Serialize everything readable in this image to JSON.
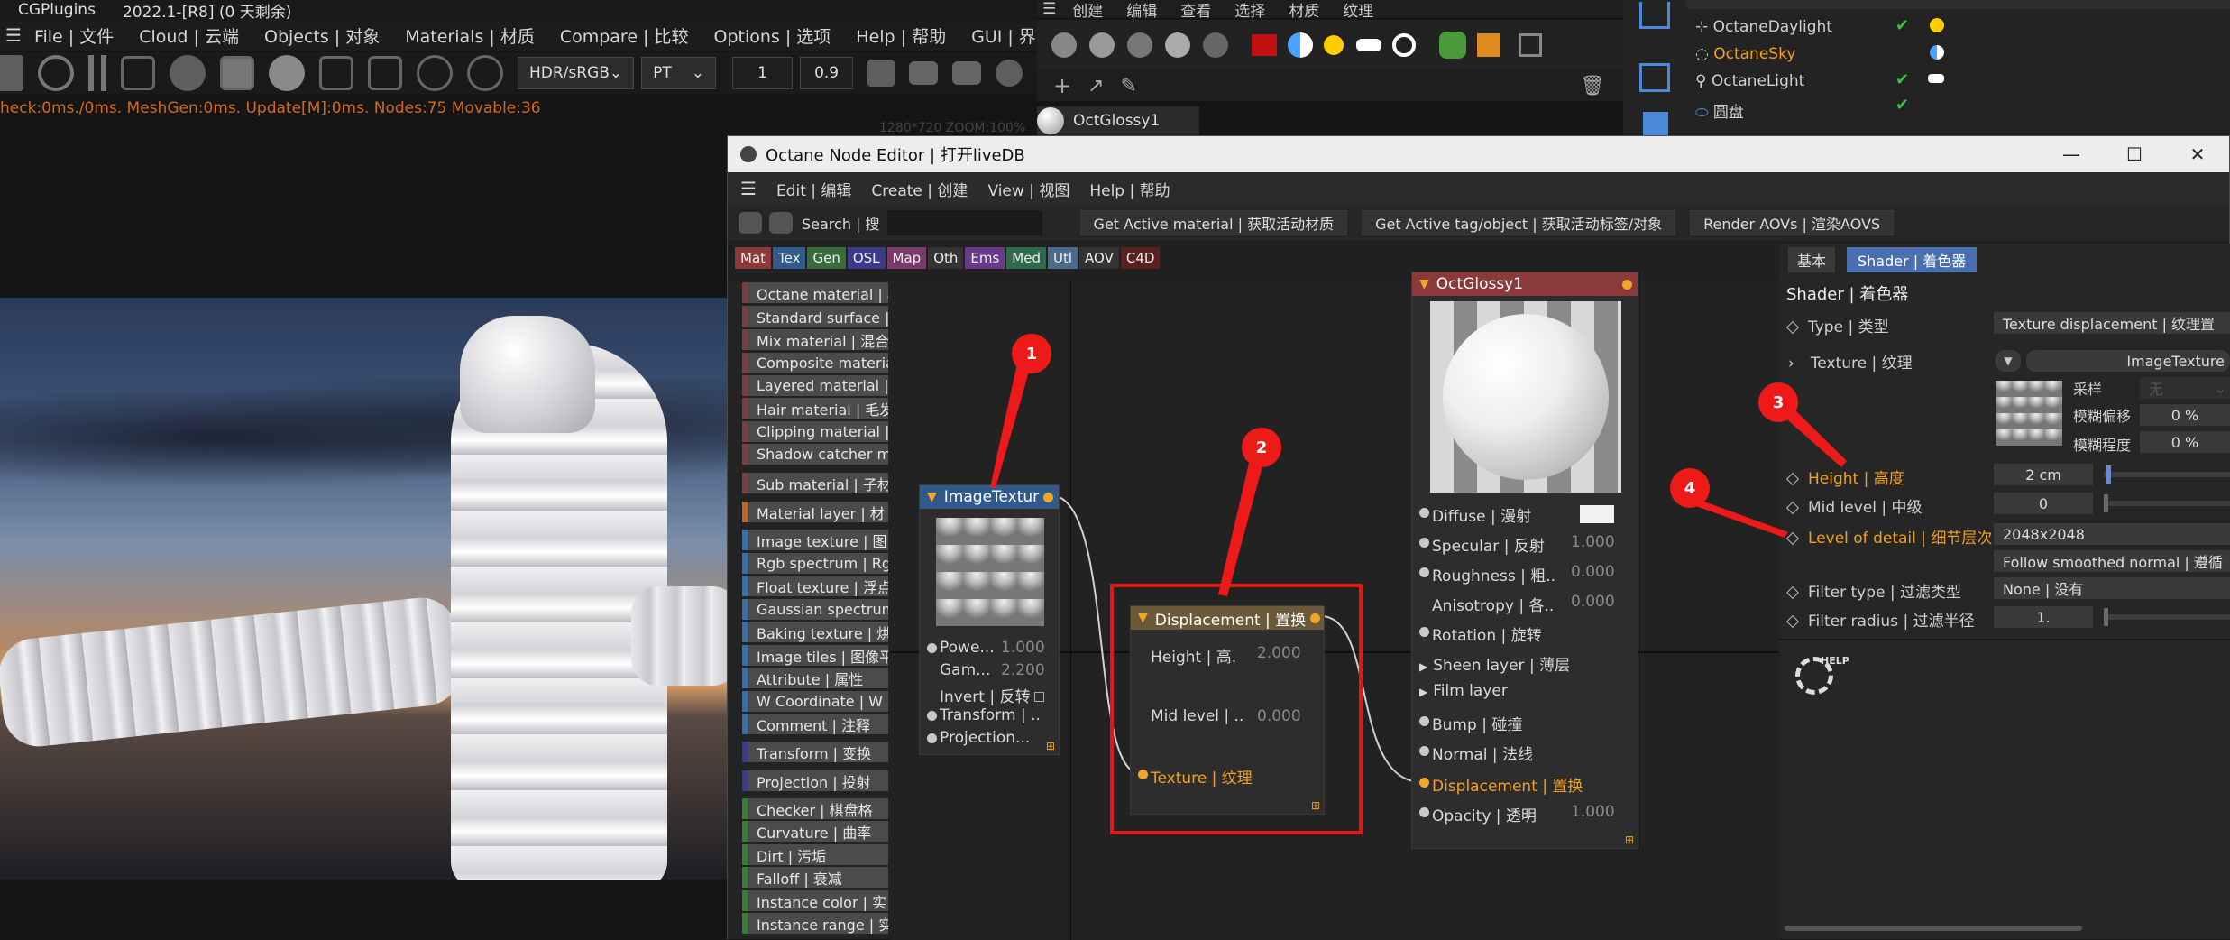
{
  "app": {
    "title": "CGPlugins",
    "version": "2022.1-[R8] (0 天剩余)"
  },
  "main_menu": [
    "File | 文件",
    "Cloud | 云端",
    "Objects | 对象",
    "Materials | 材质",
    "Compare | 比较",
    "Options | 选项",
    "Help | 帮助",
    "GUI | 界面"
  ],
  "toolbar": {
    "color_space": "HDR/sRGB",
    "kernel": "PT",
    "value1": "1",
    "value2": "0.9"
  },
  "status_line": "heck:0ms./0ms. MeshGen:0ms. Update[M]:0ms. Nodes:75 Movable:36",
  "viewport_overlay": "1280*720 ZOOM:100%",
  "c4d_menu": [
    "创建",
    "编辑",
    "查看",
    "选择",
    "材质",
    "纹理"
  ],
  "material_name": "OctGlossy1",
  "objects": [
    {
      "name": "OctaneDaylight",
      "highlight": false
    },
    {
      "name": "OctaneSky",
      "highlight": true
    },
    {
      "name": "OctaneLight",
      "highlight": false
    },
    {
      "name": "圆盘",
      "highlight": false
    }
  ],
  "node_editor": {
    "title": "Octane Node Editor | 打开liveDB",
    "menu": [
      "Edit | 编辑",
      "Create | 创建",
      "View | 视图",
      "Help | 帮助"
    ],
    "search_label": "Search | 搜",
    "buttons": [
      "Get Active material | 获取活动材质",
      "Get Active tag/object | 获取活动标签/对象",
      "Render AOVs | 渲染AOVS"
    ],
    "categories": [
      {
        "label": "Mat",
        "color": "#8a3a3a"
      },
      {
        "label": "Tex",
        "color": "#2f5a8a"
      },
      {
        "label": "Gen",
        "color": "#3a6b3a"
      },
      {
        "label": "OSL",
        "color": "#3a3a8a"
      },
      {
        "label": "Map",
        "color": "#7a3a6a"
      },
      {
        "label": "Oth",
        "color": "#333333"
      },
      {
        "label": "Ems",
        "color": "#6a3a8a"
      },
      {
        "label": "Med",
        "color": "#2f6a4a"
      },
      {
        "label": "Utl",
        "color": "#4a6a8a"
      },
      {
        "label": "AOV",
        "color": "#333333"
      },
      {
        "label": "C4D",
        "color": "#5a2020"
      }
    ],
    "palette": [
      {
        "label": "Octane material | 材",
        "color": "#9a4a4a"
      },
      {
        "label": "Standard surface | 标",
        "color": "#9a4a4a"
      },
      {
        "label": "Mix material | 混合",
        "color": "#9a4a4a"
      },
      {
        "label": "Composite material",
        "color": "#9a4a4a"
      },
      {
        "label": "Layered material |",
        "color": "#9a4a4a"
      },
      {
        "label": "Hair material | 毛发",
        "color": "#9a4a4a"
      },
      {
        "label": "Clipping material |",
        "color": "#9a4a4a"
      },
      {
        "label": "Shadow catcher m",
        "color": "#9a4a4a"
      },
      {
        "label": "Sub material | 子材",
        "color": "#9a4a4a"
      },
      {
        "label": "Material layer | 材",
        "color": "#b8682a"
      },
      {
        "label": "Image texture | 图",
        "color": "#3a6ea8"
      },
      {
        "label": "Rgb spectrum | Rg",
        "color": "#3a6ea8"
      },
      {
        "label": "Float texture | 浮点",
        "color": "#3a6ea8"
      },
      {
        "label": "Gaussian spectrum",
        "color": "#3a6ea8"
      },
      {
        "label": "Baking texture | 烘",
        "color": "#3a6ea8"
      },
      {
        "label": "Image tiles | 图像平",
        "color": "#3a6ea8"
      },
      {
        "label": "Attribute | 属性",
        "color": "#3a6ea8"
      },
      {
        "label": "W Coordinate | W",
        "color": "#3a6ea8"
      },
      {
        "label": "Comment | 注释",
        "color": "#3a6ea8"
      },
      {
        "label": "Transform | 变换",
        "color": "#3a3a8a"
      },
      {
        "label": "Projection | 投射",
        "color": "#3a3a8a"
      },
      {
        "label": "Checker | 棋盘格",
        "color": "#3a7a3a"
      },
      {
        "label": "Curvature | 曲率",
        "color": "#3a7a3a"
      },
      {
        "label": "Dirt | 污垢",
        "color": "#3a7a3a"
      },
      {
        "label": "Falloff | 衰减",
        "color": "#3a7a3a"
      },
      {
        "label": "Instance color | 实",
        "color": "#3a7a3a"
      },
      {
        "label": "Instance range | 实",
        "color": "#3a7a3a"
      }
    ],
    "image_node": {
      "title": "ImageTextur",
      "rows": [
        {
          "label": "Powe...",
          "value": "1.000"
        },
        {
          "label": "Gam...",
          "value": "2.200"
        },
        {
          "label": "Invert | 反转",
          "value": ""
        },
        {
          "label": "Transform | ..",
          "value": ""
        },
        {
          "label": "Projection...",
          "value": ""
        }
      ]
    },
    "disp_node": {
      "title": "Displacement | 置换",
      "rows": [
        {
          "label": "Height | 高.",
          "value": "2.000"
        },
        {
          "label": "Mid level | ..",
          "value": "0.000"
        },
        {
          "label": "Texture | 纹理",
          "value": ""
        }
      ]
    },
    "glossy_node": {
      "title": "OctGlossy1",
      "rows": [
        {
          "label": "Diffuse | 漫射",
          "value": ""
        },
        {
          "label": "Specular | 反射",
          "value": "1.000"
        },
        {
          "label": "Roughness | 粗..",
          "value": "0.000"
        },
        {
          "label": "Anisotropy | 各..",
          "value": "0.000"
        },
        {
          "label": "Rotation | 旋转",
          "value": ""
        },
        {
          "label": "Sheen layer | 薄层",
          "value": ""
        },
        {
          "label": "Film layer",
          "value": ""
        },
        {
          "label": "Bump | 碰撞",
          "value": ""
        },
        {
          "label": "Normal | 法线",
          "value": ""
        },
        {
          "label": "Displacement | 置换",
          "value": ""
        },
        {
          "label": "Opacity | 透明",
          "value": "1.000"
        }
      ]
    }
  },
  "inspector": {
    "tabs": [
      "基本",
      "Shader | 着色器"
    ],
    "heading": "Shader | 着色器",
    "type_label": "Type | 类型",
    "type_value": "Texture displacement | 纹理置",
    "texture_label": "Texture | 纹理",
    "texture_value": "ImageTexture",
    "sampling_label": "采样",
    "sampling_value": "无",
    "blur_offset_label": "模糊偏移",
    "blur_offset_value": "0 %",
    "blur_amount_label": "模糊程度",
    "blur_amount_value": "0 %",
    "height_label": "Height | 高度",
    "height_value": "2 cm",
    "mid_label": "Mid level | 中级",
    "mid_value": "0",
    "lod_label": "Level of detail | 细节层次",
    "lod_value": "2048x2048",
    "follow_value": "Follow smoothed normal | 遵循",
    "filter_type_label": "Filter type | 过滤类型",
    "filter_type_value": "None | 没有",
    "filter_radius_label": "Filter radius | 过滤半径",
    "filter_radius_value": "1.",
    "help_label": "HELP"
  },
  "annotations": [
    "1",
    "2",
    "3",
    "4"
  ],
  "colors": {
    "accent": "#f0a020",
    "highlight_box": "#e01818",
    "tab_active": "#4a6fb0"
  }
}
